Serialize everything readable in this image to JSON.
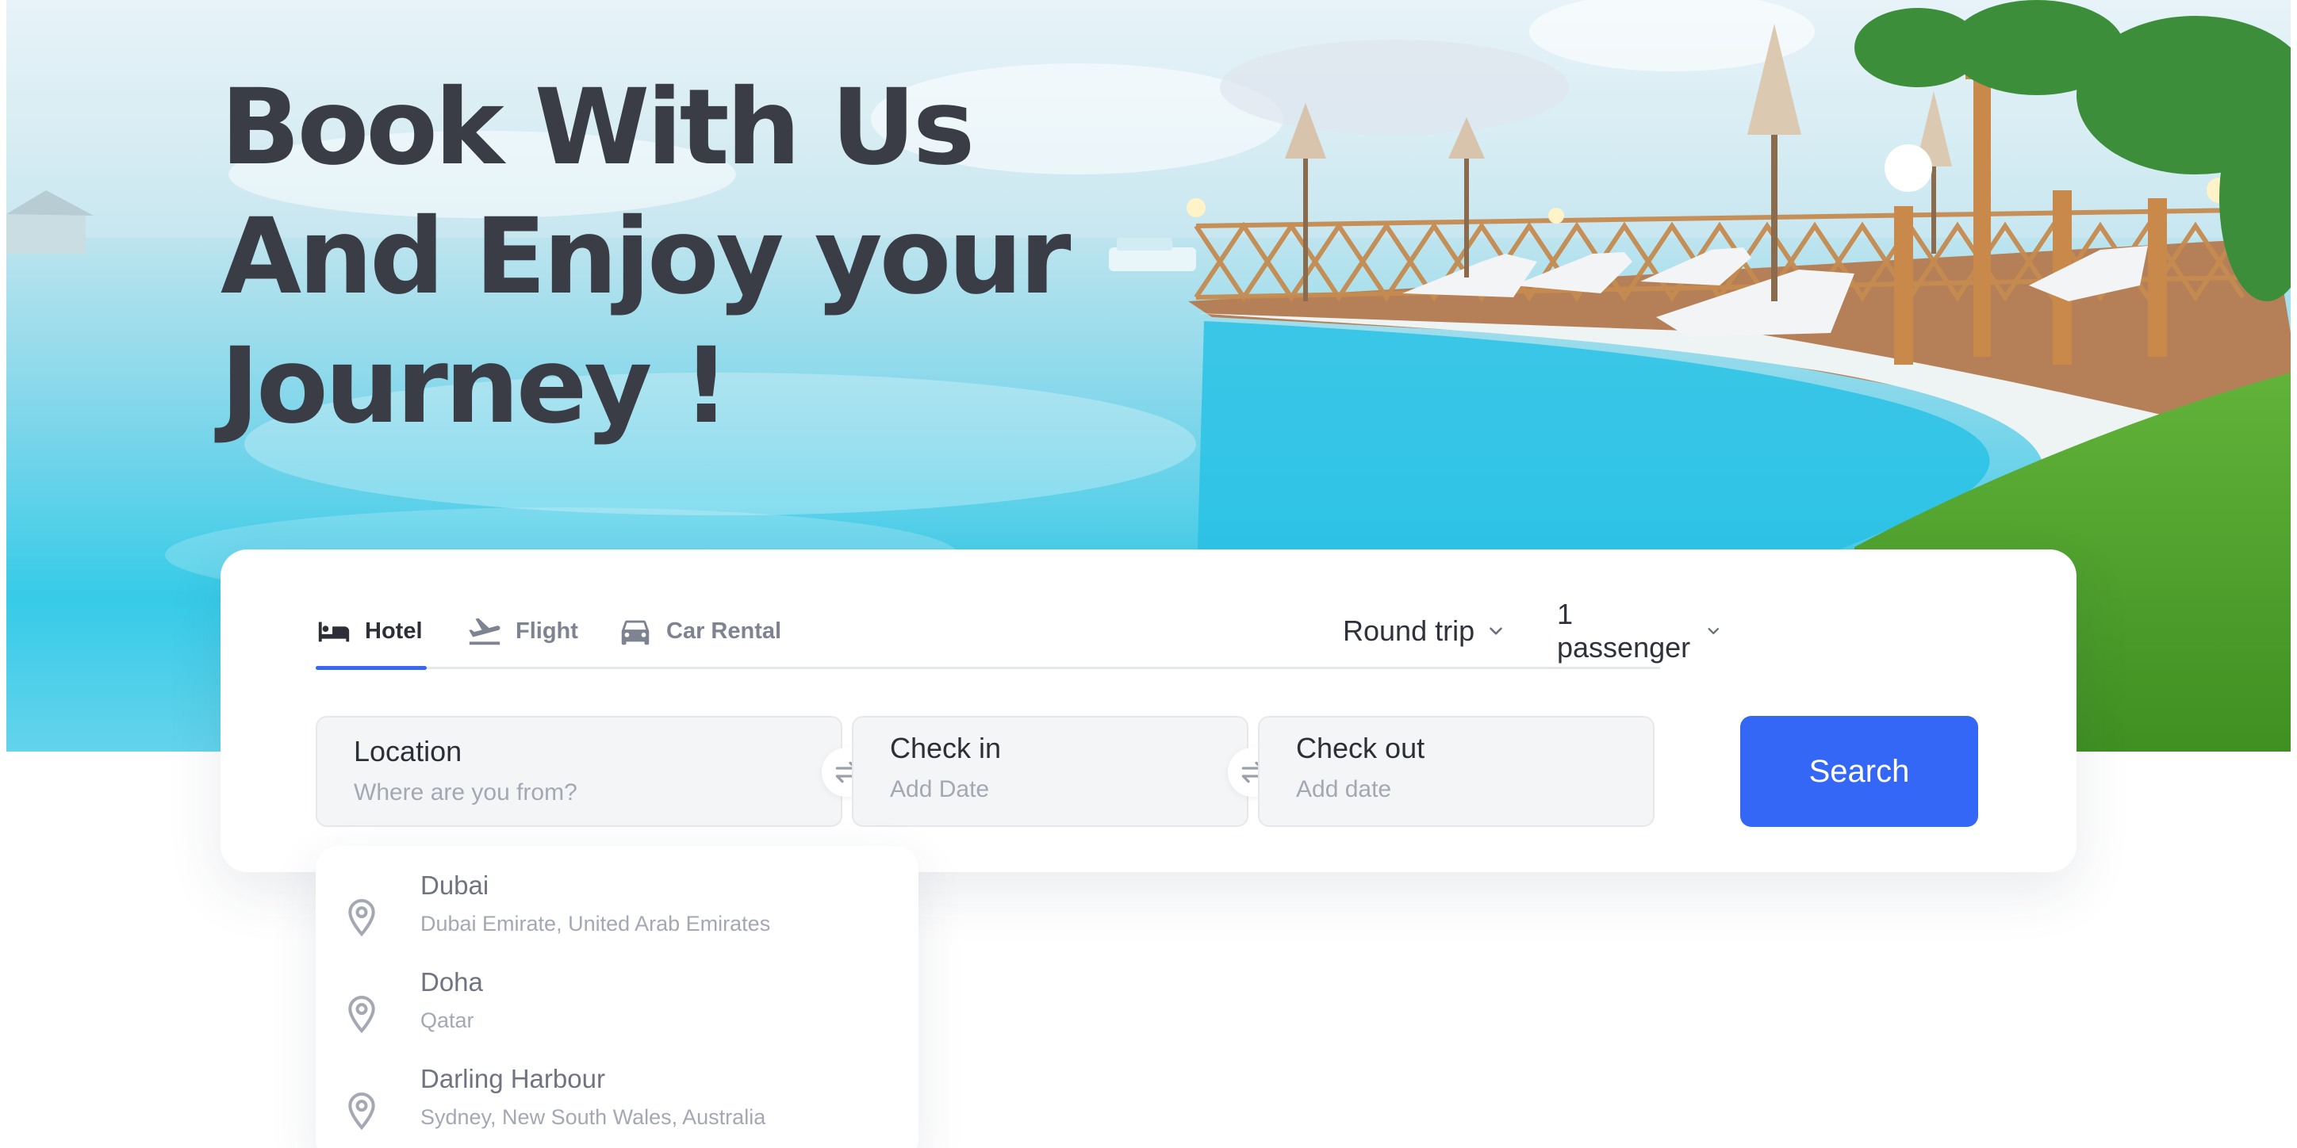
{
  "hero": {
    "headline_lines": [
      "Book With Us",
      "And Enjoy your",
      "Journey !"
    ]
  },
  "tabs": [
    {
      "label": "Hotel",
      "icon": "bed-icon",
      "active": true
    },
    {
      "label": "Flight",
      "icon": "plane-departure-icon",
      "active": false
    },
    {
      "label": "Car Rental",
      "icon": "car-icon",
      "active": false
    }
  ],
  "trip": {
    "trip_type": "Round trip",
    "passengers": "1 passenger"
  },
  "fields": {
    "location": {
      "label": "Location",
      "placeholder": "Where are you from?"
    },
    "checkin": {
      "label": "Check in",
      "placeholder": "Add Date"
    },
    "checkout": {
      "label": "Check out",
      "placeholder": "Add date"
    }
  },
  "search_label": "Search",
  "suggestions": [
    {
      "name": "Dubai",
      "detail": "Dubai Emirate, United Arab Emirates"
    },
    {
      "name": "Doha",
      "detail": "Qatar"
    },
    {
      "name": "Darling Harbour",
      "detail": "Sydney, New South Wales, Australia"
    }
  ],
  "colors": {
    "accent": "#3567f7",
    "headline": "#3a3d45",
    "muted": "#a3a8b3"
  }
}
